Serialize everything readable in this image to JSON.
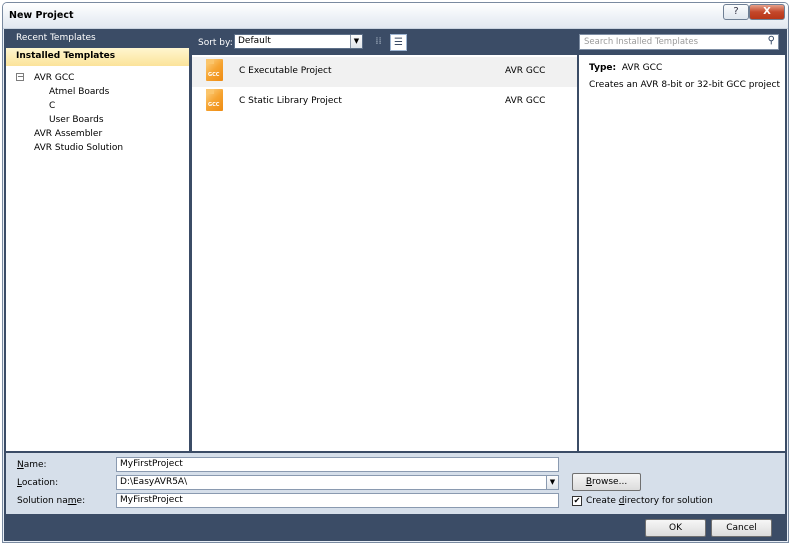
{
  "window": {
    "title": "New Project",
    "help_glyph": "?",
    "close_glyph": "X"
  },
  "left": {
    "recent_label": "Recent Templates",
    "installed_label": "Installed Templates",
    "tree": {
      "expander_glyph": "−",
      "items": [
        "AVR GCC",
        "Atmel Boards",
        "C",
        "User Boards",
        "AVR Assembler",
        "AVR Studio Solution"
      ]
    }
  },
  "toolbar": {
    "sort_label": "Sort by:",
    "sort_value": "Default"
  },
  "templates": [
    {
      "icon_text": "GCC",
      "name": "C Executable Project",
      "language": "AVR GCC"
    },
    {
      "icon_text": "GCC",
      "name": "C Static Library Project",
      "language": "AVR GCC"
    }
  ],
  "search": {
    "placeholder": "Search Installed Templates"
  },
  "details": {
    "type_label": "Type:",
    "type_value": "AVR GCC",
    "description": "Creates an AVR 8-bit or 32-bit GCC project"
  },
  "form": {
    "name_label_key": "N",
    "name_label_rest": "ame:",
    "name_value": "MyFirstProject",
    "location_label_key": "L",
    "location_label_rest": "ocation:",
    "location_value": "D:\\EasyAVR5A\\",
    "solution_label_pre": "Solution na",
    "solution_label_key": "m",
    "solution_label_rest": "e:",
    "solution_value": "MyFirstProject",
    "browse_key": "B",
    "browse_rest": "rowse...",
    "create_dir_pre": "Create ",
    "create_dir_key": "d",
    "create_dir_rest": "irectory for solution",
    "create_dir_checked": true
  },
  "buttons": {
    "ok": "OK",
    "cancel": "Cancel"
  }
}
